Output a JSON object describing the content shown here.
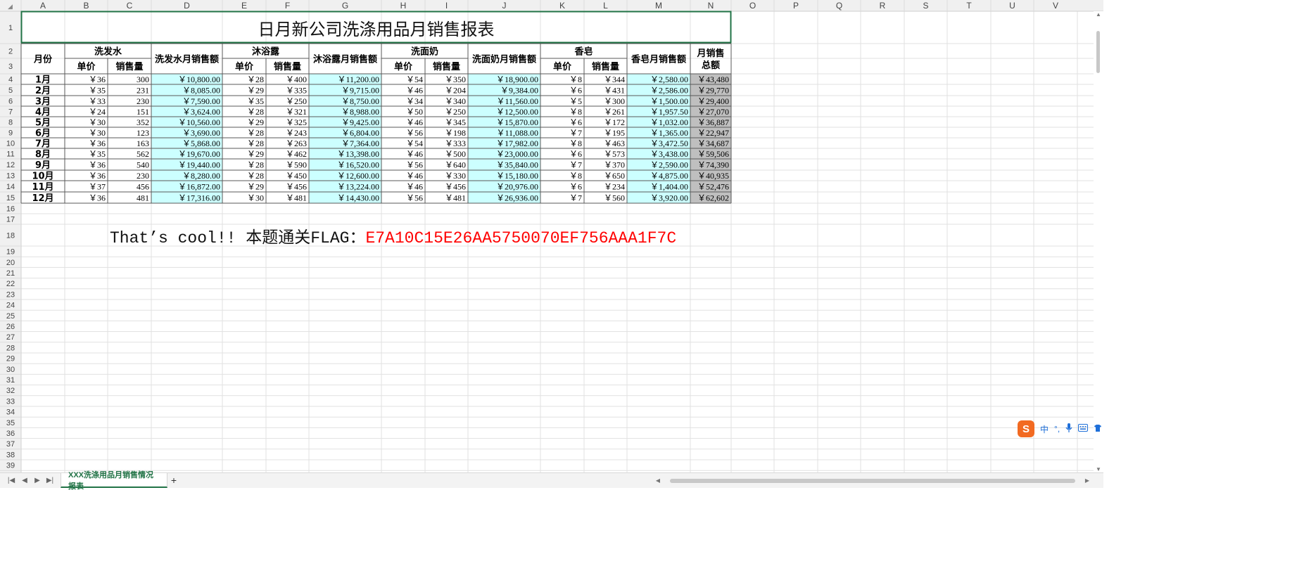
{
  "columns": [
    "A",
    "B",
    "C",
    "D",
    "E",
    "F",
    "G",
    "H",
    "I",
    "J",
    "K",
    "L",
    "M",
    "N",
    "O",
    "P",
    "Q",
    "R",
    "S",
    "T",
    "U",
    "V"
  ],
  "report": {
    "title": "日月新公司洗涤用品月销售报表",
    "header": {
      "month": "月份",
      "groups": [
        "洗发水",
        "沐浴露",
        "洗面奶",
        "香皂"
      ],
      "sub": [
        "单价",
        "销售量"
      ],
      "monthly": [
        "洗发水月销售额",
        "沐浴露月销售额",
        "洗面奶月销售额",
        "香皂月销售额"
      ],
      "total": [
        "月销售",
        "总额"
      ]
    },
    "rows": [
      [
        "1月",
        "￥36",
        "300",
        "￥10,800.00",
        "￥28",
        "￥400",
        "￥11,200.00",
        "￥54",
        "￥350",
        "￥18,900.00",
        "￥8",
        "￥344",
        "￥2,580.00",
        "￥43,480"
      ],
      [
        "2月",
        "￥35",
        "231",
        "￥8,085.00",
        "￥29",
        "￥335",
        "￥9,715.00",
        "￥46",
        "￥204",
        "￥9,384.00",
        "￥6",
        "￥431",
        "￥2,586.00",
        "￥29,770"
      ],
      [
        "3月",
        "￥33",
        "230",
        "￥7,590.00",
        "￥35",
        "￥250",
        "￥8,750.00",
        "￥34",
        "￥340",
        "￥11,560.00",
        "￥5",
        "￥300",
        "￥1,500.00",
        "￥29,400"
      ],
      [
        "4月",
        "￥24",
        "151",
        "￥3,624.00",
        "￥28",
        "￥321",
        "￥8,988.00",
        "￥50",
        "￥250",
        "￥12,500.00",
        "￥8",
        "￥261",
        "￥1,957.50",
        "￥27,070"
      ],
      [
        "5月",
        "￥30",
        "352",
        "￥10,560.00",
        "￥29",
        "￥325",
        "￥9,425.00",
        "￥46",
        "￥345",
        "￥15,870.00",
        "￥6",
        "￥172",
        "￥1,032.00",
        "￥36,887"
      ],
      [
        "6月",
        "￥30",
        "123",
        "￥3,690.00",
        "￥28",
        "￥243",
        "￥6,804.00",
        "￥56",
        "￥198",
        "￥11,088.00",
        "￥7",
        "￥195",
        "￥1,365.00",
        "￥22,947"
      ],
      [
        "7月",
        "￥36",
        "163",
        "￥5,868.00",
        "￥28",
        "￥263",
        "￥7,364.00",
        "￥54",
        "￥333",
        "￥17,982.00",
        "￥8",
        "￥463",
        "￥3,472.50",
        "￥34,687"
      ],
      [
        "8月",
        "￥35",
        "562",
        "￥19,670.00",
        "￥29",
        "￥462",
        "￥13,398.00",
        "￥46",
        "￥500",
        "￥23,000.00",
        "￥6",
        "￥573",
        "￥3,438.00",
        "￥59,506"
      ],
      [
        "9月",
        "￥36",
        "540",
        "￥19,440.00",
        "￥28",
        "￥590",
        "￥16,520.00",
        "￥56",
        "￥640",
        "￥35,840.00",
        "￥7",
        "￥370",
        "￥2,590.00",
        "￥74,390"
      ],
      [
        "10月",
        "￥36",
        "230",
        "￥8,280.00",
        "￥28",
        "￥450",
        "￥12,600.00",
        "￥46",
        "￥330",
        "￥15,180.00",
        "￥8",
        "￥650",
        "￥4,875.00",
        "￥40,935"
      ],
      [
        "11月",
        "￥37",
        "456",
        "￥16,872.00",
        "￥29",
        "￥456",
        "￥13,224.00",
        "￥46",
        "￥456",
        "￥20,976.00",
        "￥6",
        "￥234",
        "￥1,404.00",
        "￥52,476"
      ],
      [
        "12月",
        "￥36",
        "481",
        "￥17,316.00",
        "￥30",
        "￥481",
        "￥14,430.00",
        "￥56",
        "￥481",
        "￥26,936.00",
        "￥7",
        "￥560",
        "￥3,920.00",
        "￥62,602"
      ]
    ]
  },
  "flag_line": {
    "text": "That’s cool!! 本题通关FLAG：",
    "value": "E7A10C15E26AA5750070EF756AAA1F7C"
  },
  "sheet_tab": "XXX洗涤用品月销售情况报表",
  "add_sheet": "+",
  "ime": {
    "lang": "中",
    "punct": "°,",
    "logo": "S"
  },
  "colors": {
    "header_bg": "#f0f0f0",
    "grid": "#e1e1e1",
    "border": "#5a5a5a",
    "accent": "#217346",
    "cyan": "#ccffff",
    "gray_total": "#bfbfbf",
    "flag": "#ff0000"
  }
}
